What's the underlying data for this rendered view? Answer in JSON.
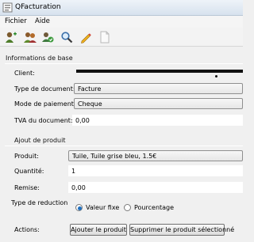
{
  "window": {
    "title": "QFacturation"
  },
  "menu": {
    "items": [
      "Fichier",
      "Aide"
    ]
  },
  "toolbar": {
    "icons": [
      "add-icon",
      "people-icon",
      "save-icon",
      "search-icon",
      "edit-pencil-icon",
      "document-icon"
    ]
  },
  "base_section": {
    "title": "Informations de base",
    "client_label": "Client:",
    "doc_type_label": "Type de document:",
    "doc_type_value": "Facture",
    "payment_label": "Mode de paiement:",
    "payment_value": "Cheque",
    "tva_label": "TVA du document:",
    "tva_value": "0,00"
  },
  "product_section": {
    "title": "Ajout de produit",
    "product_label": "Produit:",
    "product_value": "Tuile, Tuile grise bleu, 1.5€",
    "quantity_label": "Quantité:",
    "quantity_value": "1",
    "discount_label": "Remise:",
    "discount_value": "0,00",
    "reduction_label": "Type de reduction",
    "reduction_options": [
      "Valeur fixe",
      "Pourcentage"
    ],
    "reduction_selected": "Valeur fixe",
    "actions_label": "Actions:",
    "add_button": "Ajouter le produit",
    "remove_button": "Supprimer le produit sélectionné"
  }
}
